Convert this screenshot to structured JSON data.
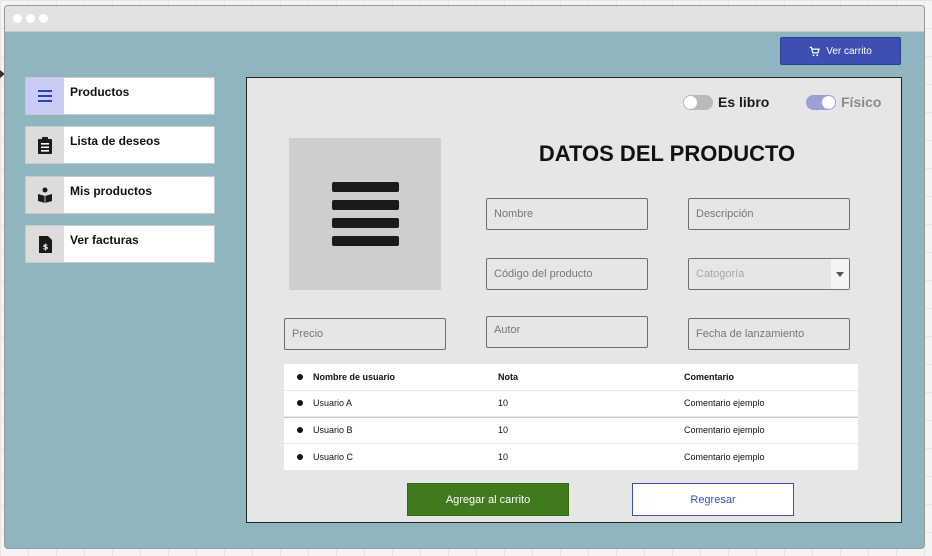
{
  "header": {
    "cart_button_label": "Ver carrito",
    "cart_icon": "cart-icon"
  },
  "sidebar": {
    "items": [
      {
        "label": "Productos",
        "icon": "list-icon",
        "active": true
      },
      {
        "label": "Lista de deseos",
        "icon": "clipboard-icon",
        "active": false
      },
      {
        "label": "Mis productos",
        "icon": "user-box-icon",
        "active": false
      },
      {
        "label": "Ver facturas",
        "icon": "invoice-icon",
        "active": false
      }
    ]
  },
  "product": {
    "title": "DATOS DEL PRODUCTO",
    "image_icon": "menu-lines-icon",
    "toggles": {
      "es_libro": {
        "label": "Es libro",
        "on": false
      },
      "fisico": {
        "label": "Físico",
        "on": true
      }
    },
    "fields": {
      "nombre": {
        "placeholder": "Nombre"
      },
      "descripcion": {
        "placeholder": "Descripción"
      },
      "codigo": {
        "placeholder": "Código del producto"
      },
      "categoria": {
        "placeholder": "Catogoría"
      },
      "precio": {
        "placeholder": "Precio"
      },
      "autor": {
        "placeholder": "Autor"
      },
      "fecha": {
        "placeholder": "Fecha de lanzamiento"
      }
    }
  },
  "reviews": {
    "columns": [
      "Nombre de usuario",
      "Nota",
      "Comentario"
    ],
    "rows": [
      [
        "Usuario A",
        "10",
        "Comentario ejemplo"
      ],
      [
        "Usuario B",
        "10",
        "Comentario ejemplo"
      ],
      [
        "Usuario C",
        "10",
        "Comentario ejemplo"
      ]
    ]
  },
  "actions": {
    "add_to_cart": "Agregar al carrito",
    "back": "Regresar"
  },
  "colors": {
    "background": "#8fb5bf",
    "accent": "#3d4fb3",
    "primary_action": "#3f7a1c"
  }
}
